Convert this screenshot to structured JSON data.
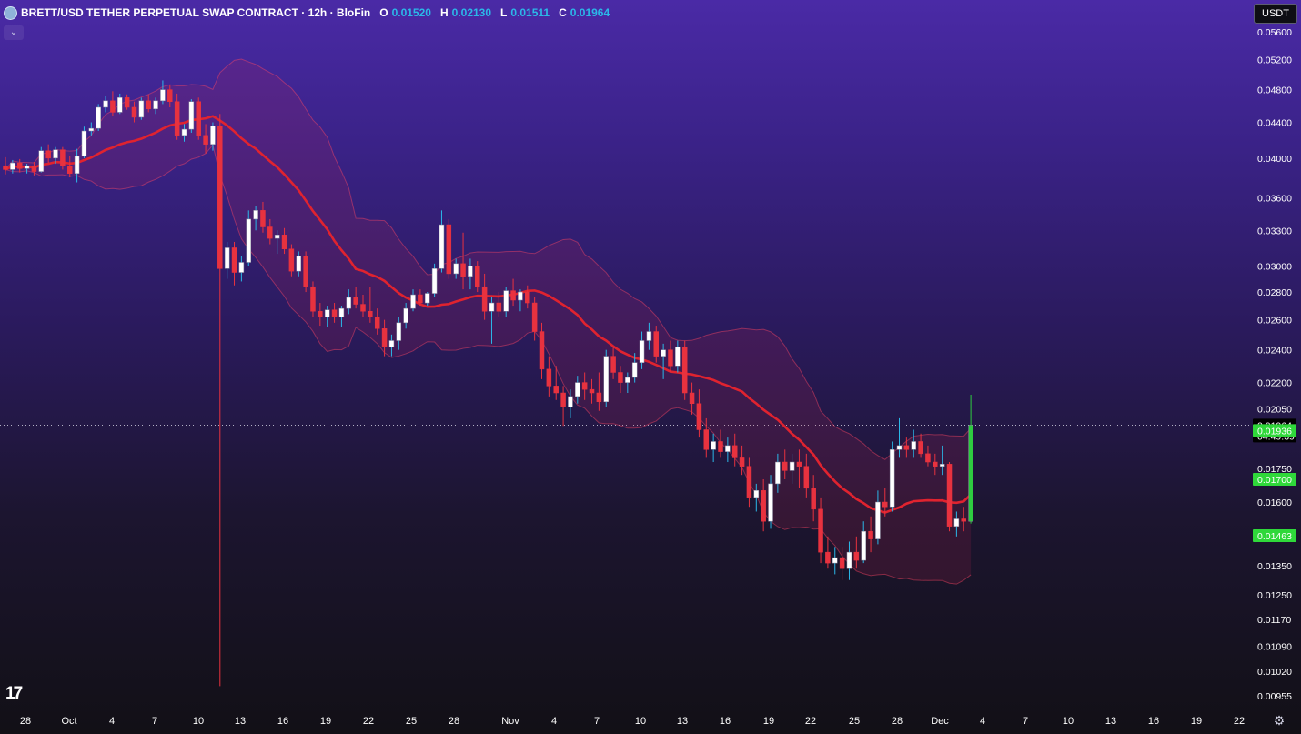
{
  "header": {
    "title": "BRETT/USD TETHER PERPETUAL SWAP CONTRACT · 12h · BloFin",
    "o_key": "O",
    "o_val": "0.01520",
    "h_key": "H",
    "h_val": "0.02130",
    "l_key": "L",
    "l_val": "0.01511",
    "c_key": "C",
    "c_val": "0.01964"
  },
  "currency_button": "USDT",
  "collapse_icon": "chevron-down-icon",
  "settings_icon": "gear-icon",
  "logo_text": "17",
  "colors": {
    "up": "#ffffff",
    "down": "#e8323f",
    "wick_up": "#2bb8e8",
    "basis": "#e0232f",
    "band": "#ff3050",
    "last_candle": "#2ecc40",
    "price_tag": "#000000",
    "marker_tag": "#2fd83a"
  },
  "chart_data": {
    "type": "candlestick",
    "title": "BRETT/USD TETHER PERPETUAL SWAP CONTRACT · 12h · BloFin",
    "timeframe": "12h",
    "y_scale": "log",
    "y_ticks": [
      "0.05600",
      "0.05200",
      "0.04800",
      "0.04400",
      "0.04000",
      "0.03600",
      "0.03300",
      "0.03000",
      "0.02800",
      "0.02600",
      "0.02400",
      "0.02200",
      "0.02050",
      "0.01750",
      "0.01600",
      "0.01350",
      "0.01250",
      "0.01170",
      "0.01090",
      "0.01020",
      "0.00955"
    ],
    "x_ticks": [
      "28",
      "Oct",
      "4",
      "7",
      "10",
      "13",
      "16",
      "19",
      "22",
      "25",
      "28",
      "Nov",
      "4",
      "7",
      "10",
      "13",
      "16",
      "19",
      "22",
      "25",
      "28",
      "Dec",
      "4",
      "7",
      "10",
      "13",
      "16",
      "19",
      "22"
    ],
    "candles": [
      {
        "t": "Sep 26 00:00",
        "o": 0.0392,
        "h": 0.0401,
        "l": 0.0383,
        "c": 0.0388
      },
      {
        "t": "Sep 26 12:00",
        "o": 0.0388,
        "h": 0.0398,
        "l": 0.0384,
        "c": 0.0395
      },
      {
        "t": "Sep 27 00:00",
        "o": 0.0395,
        "h": 0.0399,
        "l": 0.0385,
        "c": 0.0389
      },
      {
        "t": "Sep 27 12:00",
        "o": 0.0389,
        "h": 0.0394,
        "l": 0.0384,
        "c": 0.0392
      },
      {
        "t": "Sep 28 00:00",
        "o": 0.0392,
        "h": 0.0396,
        "l": 0.0382,
        "c": 0.0386
      },
      {
        "t": "Sep 28 12:00",
        "o": 0.0386,
        "h": 0.0412,
        "l": 0.0385,
        "c": 0.0408
      },
      {
        "t": "Sep 29 00:00",
        "o": 0.0408,
        "h": 0.0415,
        "l": 0.0395,
        "c": 0.04
      },
      {
        "t": "Sep 29 12:00",
        "o": 0.04,
        "h": 0.0412,
        "l": 0.0394,
        "c": 0.0409
      },
      {
        "t": "Sep 30 00:00",
        "o": 0.0409,
        "h": 0.0412,
        "l": 0.0388,
        "c": 0.0392
      },
      {
        "t": "Sep 30 12:00",
        "o": 0.0392,
        "h": 0.0402,
        "l": 0.038,
        "c": 0.0384
      },
      {
        "t": "Oct 1 00:00",
        "o": 0.0384,
        "h": 0.041,
        "l": 0.0375,
        "c": 0.0402
      },
      {
        "t": "Oct 1 12:00",
        "o": 0.0402,
        "h": 0.0435,
        "l": 0.04,
        "c": 0.043
      },
      {
        "t": "Oct 2 00:00",
        "o": 0.043,
        "h": 0.044,
        "l": 0.0425,
        "c": 0.0433
      },
      {
        "t": "Oct 2 12:00",
        "o": 0.0433,
        "h": 0.0462,
        "l": 0.043,
        "c": 0.0458
      },
      {
        "t": "Oct 3 00:00",
        "o": 0.0458,
        "h": 0.0472,
        "l": 0.0452,
        "c": 0.0466
      },
      {
        "t": "Oct 3 12:00",
        "o": 0.0466,
        "h": 0.0478,
        "l": 0.0448,
        "c": 0.0452
      },
      {
        "t": "Oct 4 00:00",
        "o": 0.0452,
        "h": 0.0475,
        "l": 0.045,
        "c": 0.047
      },
      {
        "t": "Oct 4 12:00",
        "o": 0.047,
        "h": 0.0474,
        "l": 0.0455,
        "c": 0.0458
      },
      {
        "t": "Oct 5 00:00",
        "o": 0.0458,
        "h": 0.0465,
        "l": 0.044,
        "c": 0.0446
      },
      {
        "t": "Oct 5 12:00",
        "o": 0.0446,
        "h": 0.047,
        "l": 0.0443,
        "c": 0.0466
      },
      {
        "t": "Oct 6 00:00",
        "o": 0.0466,
        "h": 0.0474,
        "l": 0.0452,
        "c": 0.0456
      },
      {
        "t": "Oct 6 12:00",
        "o": 0.0456,
        "h": 0.047,
        "l": 0.045,
        "c": 0.0466
      },
      {
        "t": "Oct 7 00:00",
        "o": 0.0466,
        "h": 0.0492,
        "l": 0.0462,
        "c": 0.048
      },
      {
        "t": "Oct 7 12:00",
        "o": 0.048,
        "h": 0.0486,
        "l": 0.0458,
        "c": 0.0465
      },
      {
        "t": "Oct 8 00:00",
        "o": 0.0465,
        "h": 0.0475,
        "l": 0.042,
        "c": 0.0425
      },
      {
        "t": "Oct 8 12:00",
        "o": 0.0425,
        "h": 0.0438,
        "l": 0.0418,
        "c": 0.0432
      },
      {
        "t": "Oct 9 00:00",
        "o": 0.0432,
        "h": 0.0468,
        "l": 0.0428,
        "c": 0.0465
      },
      {
        "t": "Oct 9 12:00",
        "o": 0.0465,
        "h": 0.047,
        "l": 0.042,
        "c": 0.0425
      },
      {
        "t": "Oct 10 00:00",
        "o": 0.0425,
        "h": 0.0438,
        "l": 0.0405,
        "c": 0.0415
      },
      {
        "t": "Oct 10 12:00",
        "o": 0.0415,
        "h": 0.044,
        "l": 0.0408,
        "c": 0.0436
      },
      {
        "t": "Oct 11 00:00",
        "o": 0.0436,
        "h": 0.045,
        "l": 0.0098,
        "c": 0.0298
      },
      {
        "t": "Oct 11 12:00",
        "o": 0.0298,
        "h": 0.032,
        "l": 0.029,
        "c": 0.0315
      },
      {
        "t": "Oct 12 00:00",
        "o": 0.0315,
        "h": 0.032,
        "l": 0.0285,
        "c": 0.0295
      },
      {
        "t": "Oct 12 12:00",
        "o": 0.0295,
        "h": 0.0308,
        "l": 0.0288,
        "c": 0.0303
      },
      {
        "t": "Oct 13 00:00",
        "o": 0.0303,
        "h": 0.0348,
        "l": 0.03,
        "c": 0.034
      },
      {
        "t": "Oct 13 12:00",
        "o": 0.034,
        "h": 0.0352,
        "l": 0.033,
        "c": 0.0348
      },
      {
        "t": "Oct 14 00:00",
        "o": 0.0348,
        "h": 0.0356,
        "l": 0.0328,
        "c": 0.0333
      },
      {
        "t": "Oct 14 12:00",
        "o": 0.0333,
        "h": 0.034,
        "l": 0.0318,
        "c": 0.0323
      },
      {
        "t": "Oct 15 00:00",
        "o": 0.0323,
        "h": 0.033,
        "l": 0.031,
        "c": 0.0326
      },
      {
        "t": "Oct 15 12:00",
        "o": 0.0326,
        "h": 0.0332,
        "l": 0.031,
        "c": 0.0314
      },
      {
        "t": "Oct 16 00:00",
        "o": 0.0314,
        "h": 0.0318,
        "l": 0.0292,
        "c": 0.0296
      },
      {
        "t": "Oct 16 12:00",
        "o": 0.0296,
        "h": 0.0312,
        "l": 0.0292,
        "c": 0.0308
      },
      {
        "t": "Oct 17 00:00",
        "o": 0.0308,
        "h": 0.0312,
        "l": 0.028,
        "c": 0.0284
      },
      {
        "t": "Oct 17 12:00",
        "o": 0.0284,
        "h": 0.0288,
        "l": 0.0262,
        "c": 0.0266
      },
      {
        "t": "Oct 18 00:00",
        "o": 0.0266,
        "h": 0.0272,
        "l": 0.0256,
        "c": 0.0262
      },
      {
        "t": "Oct 18 12:00",
        "o": 0.0262,
        "h": 0.027,
        "l": 0.0255,
        "c": 0.0267
      },
      {
        "t": "Oct 19 00:00",
        "o": 0.0267,
        "h": 0.0272,
        "l": 0.0258,
        "c": 0.0262
      },
      {
        "t": "Oct 19 12:00",
        "o": 0.0262,
        "h": 0.027,
        "l": 0.0255,
        "c": 0.0268
      },
      {
        "t": "Oct 20 00:00",
        "o": 0.0268,
        "h": 0.0282,
        "l": 0.0264,
        "c": 0.0276
      },
      {
        "t": "Oct 20 12:00",
        "o": 0.0276,
        "h": 0.0284,
        "l": 0.0268,
        "c": 0.0271
      },
      {
        "t": "Oct 21 00:00",
        "o": 0.0271,
        "h": 0.0278,
        "l": 0.0262,
        "c": 0.0266
      },
      {
        "t": "Oct 21 12:00",
        "o": 0.0266,
        "h": 0.0284,
        "l": 0.0258,
        "c": 0.0262
      },
      {
        "t": "Oct 22 00:00",
        "o": 0.0262,
        "h": 0.0268,
        "l": 0.025,
        "c": 0.0254
      },
      {
        "t": "Oct 22 12:00",
        "o": 0.0254,
        "h": 0.026,
        "l": 0.0236,
        "c": 0.0242
      },
      {
        "t": "Oct 23 00:00",
        "o": 0.0242,
        "h": 0.025,
        "l": 0.0236,
        "c": 0.0246
      },
      {
        "t": "Oct 23 12:00",
        "o": 0.0246,
        "h": 0.0262,
        "l": 0.024,
        "c": 0.0258
      },
      {
        "t": "Oct 24 00:00",
        "o": 0.0258,
        "h": 0.0272,
        "l": 0.0254,
        "c": 0.0268
      },
      {
        "t": "Oct 24 12:00",
        "o": 0.0268,
        "h": 0.0282,
        "l": 0.0266,
        "c": 0.0278
      },
      {
        "t": "Oct 25 00:00",
        "o": 0.0278,
        "h": 0.0282,
        "l": 0.027,
        "c": 0.0272
      },
      {
        "t": "Oct 25 12:00",
        "o": 0.0272,
        "h": 0.028,
        "l": 0.027,
        "c": 0.0279
      },
      {
        "t": "Oct 26 00:00",
        "o": 0.0279,
        "h": 0.0302,
        "l": 0.0276,
        "c": 0.0298
      },
      {
        "t": "Oct 26 12:00",
        "o": 0.0298,
        "h": 0.0348,
        "l": 0.0295,
        "c": 0.0335
      },
      {
        "t": "Oct 27 00:00",
        "o": 0.0335,
        "h": 0.034,
        "l": 0.029,
        "c": 0.0294
      },
      {
        "t": "Oct 27 12:00",
        "o": 0.0294,
        "h": 0.0306,
        "l": 0.029,
        "c": 0.0302
      },
      {
        "t": "Oct 28 00:00",
        "o": 0.0302,
        "h": 0.0328,
        "l": 0.0282,
        "c": 0.0292
      },
      {
        "t": "Oct 28 12:00",
        "o": 0.0292,
        "h": 0.0306,
        "l": 0.0282,
        "c": 0.03
      },
      {
        "t": "Oct 29 00:00",
        "o": 0.03,
        "h": 0.0304,
        "l": 0.028,
        "c": 0.0284
      },
      {
        "t": "Oct 29 12:00",
        "o": 0.0284,
        "h": 0.0294,
        "l": 0.026,
        "c": 0.0266
      },
      {
        "t": "Oct 30 00:00",
        "o": 0.0266,
        "h": 0.0276,
        "l": 0.0244,
        "c": 0.0272
      },
      {
        "t": "Oct 30 12:00",
        "o": 0.0272,
        "h": 0.028,
        "l": 0.0262,
        "c": 0.0266
      },
      {
        "t": "Oct 31 00:00",
        "o": 0.0266,
        "h": 0.0284,
        "l": 0.0262,
        "c": 0.0281
      },
      {
        "t": "Oct 31 12:00",
        "o": 0.0281,
        "h": 0.029,
        "l": 0.027,
        "c": 0.0274
      },
      {
        "t": "Nov 1 00:00",
        "o": 0.0274,
        "h": 0.0282,
        "l": 0.0266,
        "c": 0.028
      },
      {
        "t": "Nov 1 12:00",
        "o": 0.028,
        "h": 0.0285,
        "l": 0.0268,
        "c": 0.0272
      },
      {
        "t": "Nov 2 00:00",
        "o": 0.0272,
        "h": 0.0276,
        "l": 0.0246,
        "c": 0.0252
      },
      {
        "t": "Nov 2 12:00",
        "o": 0.0252,
        "h": 0.0258,
        "l": 0.0222,
        "c": 0.0228
      },
      {
        "t": "Nov 3 00:00",
        "o": 0.0228,
        "h": 0.0236,
        "l": 0.0212,
        "c": 0.0218
      },
      {
        "t": "Nov 3 12:00",
        "o": 0.0218,
        "h": 0.023,
        "l": 0.021,
        "c": 0.0214
      },
      {
        "t": "Nov 4 00:00",
        "o": 0.0214,
        "h": 0.0218,
        "l": 0.0196,
        "c": 0.0206
      },
      {
        "t": "Nov 4 12:00",
        "o": 0.0206,
        "h": 0.0216,
        "l": 0.02,
        "c": 0.0212
      },
      {
        "t": "Nov 5 00:00",
        "o": 0.0212,
        "h": 0.0224,
        "l": 0.0208,
        "c": 0.022
      },
      {
        "t": "Nov 5 12:00",
        "o": 0.022,
        "h": 0.0226,
        "l": 0.021,
        "c": 0.0216
      },
      {
        "t": "Nov 6 00:00",
        "o": 0.0216,
        "h": 0.0222,
        "l": 0.0208,
        "c": 0.0214
      },
      {
        "t": "Nov 6 12:00",
        "o": 0.0214,
        "h": 0.0226,
        "l": 0.0204,
        "c": 0.0209
      },
      {
        "t": "Nov 7 00:00",
        "o": 0.0209,
        "h": 0.024,
        "l": 0.0206,
        "c": 0.0236
      },
      {
        "t": "Nov 7 12:00",
        "o": 0.0236,
        "h": 0.0242,
        "l": 0.0222,
        "c": 0.0226
      },
      {
        "t": "Nov 8 00:00",
        "o": 0.0226,
        "h": 0.023,
        "l": 0.0214,
        "c": 0.022
      },
      {
        "t": "Nov 8 12:00",
        "o": 0.022,
        "h": 0.0226,
        "l": 0.0214,
        "c": 0.0223
      },
      {
        "t": "Nov 9 00:00",
        "o": 0.0223,
        "h": 0.0238,
        "l": 0.022,
        "c": 0.0232
      },
      {
        "t": "Nov 9 12:00",
        "o": 0.0232,
        "h": 0.0252,
        "l": 0.0228,
        "c": 0.0246
      },
      {
        "t": "Nov 10 00:00",
        "o": 0.0246,
        "h": 0.0258,
        "l": 0.024,
        "c": 0.0252
      },
      {
        "t": "Nov 10 12:00",
        "o": 0.0252,
        "h": 0.0256,
        "l": 0.0232,
        "c": 0.0236
      },
      {
        "t": "Nov 11 00:00",
        "o": 0.0236,
        "h": 0.0244,
        "l": 0.0222,
        "c": 0.024
      },
      {
        "t": "Nov 11 12:00",
        "o": 0.024,
        "h": 0.0246,
        "l": 0.0226,
        "c": 0.023
      },
      {
        "t": "Nov 12 00:00",
        "o": 0.023,
        "h": 0.0246,
        "l": 0.0226,
        "c": 0.0242
      },
      {
        "t": "Nov 12 12:00",
        "o": 0.0242,
        "h": 0.0246,
        "l": 0.021,
        "c": 0.0214
      },
      {
        "t": "Nov 13 00:00",
        "o": 0.0214,
        "h": 0.022,
        "l": 0.0202,
        "c": 0.0208
      },
      {
        "t": "Nov 13 12:00",
        "o": 0.0208,
        "h": 0.0216,
        "l": 0.019,
        "c": 0.0194
      },
      {
        "t": "Nov 14 00:00",
        "o": 0.0194,
        "h": 0.02,
        "l": 0.018,
        "c": 0.0184
      },
      {
        "t": "Nov 14 12:00",
        "o": 0.0184,
        "h": 0.0192,
        "l": 0.0178,
        "c": 0.0188
      },
      {
        "t": "Nov 15 00:00",
        "o": 0.0188,
        "h": 0.0194,
        "l": 0.018,
        "c": 0.0183
      },
      {
        "t": "Nov 15 12:00",
        "o": 0.0183,
        "h": 0.019,
        "l": 0.0178,
        "c": 0.0186
      },
      {
        "t": "Nov 16 00:00",
        "o": 0.0186,
        "h": 0.0192,
        "l": 0.0176,
        "c": 0.018
      },
      {
        "t": "Nov 16 12:00",
        "o": 0.018,
        "h": 0.0186,
        "l": 0.0172,
        "c": 0.0176
      },
      {
        "t": "Nov 17 00:00",
        "o": 0.0176,
        "h": 0.018,
        "l": 0.0158,
        "c": 0.0162
      },
      {
        "t": "Nov 17 12:00",
        "o": 0.0162,
        "h": 0.0168,
        "l": 0.0156,
        "c": 0.0165
      },
      {
        "t": "Nov 18 00:00",
        "o": 0.0165,
        "h": 0.017,
        "l": 0.0148,
        "c": 0.0152
      },
      {
        "t": "Nov 18 12:00",
        "o": 0.0152,
        "h": 0.0172,
        "l": 0.0149,
        "c": 0.0168
      },
      {
        "t": "Nov 19 00:00",
        "o": 0.0168,
        "h": 0.0182,
        "l": 0.0164,
        "c": 0.0178
      },
      {
        "t": "Nov 19 12:00",
        "o": 0.0178,
        "h": 0.0184,
        "l": 0.017,
        "c": 0.0174
      },
      {
        "t": "Nov 20 00:00",
        "o": 0.0174,
        "h": 0.0182,
        "l": 0.0168,
        "c": 0.0178
      },
      {
        "t": "Nov 20 12:00",
        "o": 0.0178,
        "h": 0.0184,
        "l": 0.0166,
        "c": 0.0176
      },
      {
        "t": "Nov 21 00:00",
        "o": 0.0176,
        "h": 0.0182,
        "l": 0.0162,
        "c": 0.0166
      },
      {
        "t": "Nov 21 12:00",
        "o": 0.0166,
        "h": 0.0172,
        "l": 0.0152,
        "c": 0.0157
      },
      {
        "t": "Nov 22 00:00",
        "o": 0.0157,
        "h": 0.0162,
        "l": 0.0136,
        "c": 0.014
      },
      {
        "t": "Nov 22 12:00",
        "o": 0.014,
        "h": 0.0146,
        "l": 0.0134,
        "c": 0.0136
      },
      {
        "t": "Nov 23 00:00",
        "o": 0.0136,
        "h": 0.0142,
        "l": 0.0132,
        "c": 0.0138
      },
      {
        "t": "Nov 23 12:00",
        "o": 0.0138,
        "h": 0.0142,
        "l": 0.013,
        "c": 0.0134
      },
      {
        "t": "Nov 24 00:00",
        "o": 0.0134,
        "h": 0.0144,
        "l": 0.013,
        "c": 0.014
      },
      {
        "t": "Nov 24 12:00",
        "o": 0.014,
        "h": 0.0146,
        "l": 0.0134,
        "c": 0.0137
      },
      {
        "t": "Nov 25 00:00",
        "o": 0.0137,
        "h": 0.0152,
        "l": 0.0136,
        "c": 0.0148
      },
      {
        "t": "Nov 25 12:00",
        "o": 0.0148,
        "h": 0.0154,
        "l": 0.014,
        "c": 0.0145
      },
      {
        "t": "Nov 26 00:00",
        "o": 0.0145,
        "h": 0.0165,
        "l": 0.0143,
        "c": 0.016
      },
      {
        "t": "Nov 26 12:00",
        "o": 0.016,
        "h": 0.0166,
        "l": 0.0154,
        "c": 0.0158
      },
      {
        "t": "Nov 27 00:00",
        "o": 0.0158,
        "h": 0.0188,
        "l": 0.0156,
        "c": 0.0184
      },
      {
        "t": "Nov 27 12:00",
        "o": 0.0184,
        "h": 0.02,
        "l": 0.018,
        "c": 0.0186
      },
      {
        "t": "Nov 28 00:00",
        "o": 0.0186,
        "h": 0.019,
        "l": 0.018,
        "c": 0.0184
      },
      {
        "t": "Nov 28 12:00",
        "o": 0.0184,
        "h": 0.0194,
        "l": 0.018,
        "c": 0.0188
      },
      {
        "t": "Nov 29 00:00",
        "o": 0.0188,
        "h": 0.0192,
        "l": 0.018,
        "c": 0.0182
      },
      {
        "t": "Nov 29 12:00",
        "o": 0.0182,
        "h": 0.0186,
        "l": 0.0176,
        "c": 0.0178
      },
      {
        "t": "Nov 30 00:00",
        "o": 0.0178,
        "h": 0.0182,
        "l": 0.0172,
        "c": 0.0176
      },
      {
        "t": "Nov 30 12:00",
        "o": 0.0176,
        "h": 0.0186,
        "l": 0.0172,
        "c": 0.0177
      },
      {
        "t": "Dec 1 00:00",
        "o": 0.0177,
        "h": 0.0178,
        "l": 0.0148,
        "c": 0.015
      },
      {
        "t": "Dec 1 12:00",
        "o": 0.015,
        "h": 0.0156,
        "l": 0.0146,
        "c": 0.0153
      },
      {
        "t": "Dec 2 00:00",
        "o": 0.0153,
        "h": 0.0158,
        "l": 0.0148,
        "c": 0.0152
      },
      {
        "t": "Dec 2 12:00",
        "o": 0.0152,
        "h": 0.0213,
        "l": 0.01511,
        "c": 0.01964
      }
    ],
    "indicators": {
      "basis_last": "0.01700",
      "upper_last": "0.01936",
      "lower_last": "0.01463"
    },
    "last_price": "0.01964",
    "countdown": "04:49:39"
  }
}
